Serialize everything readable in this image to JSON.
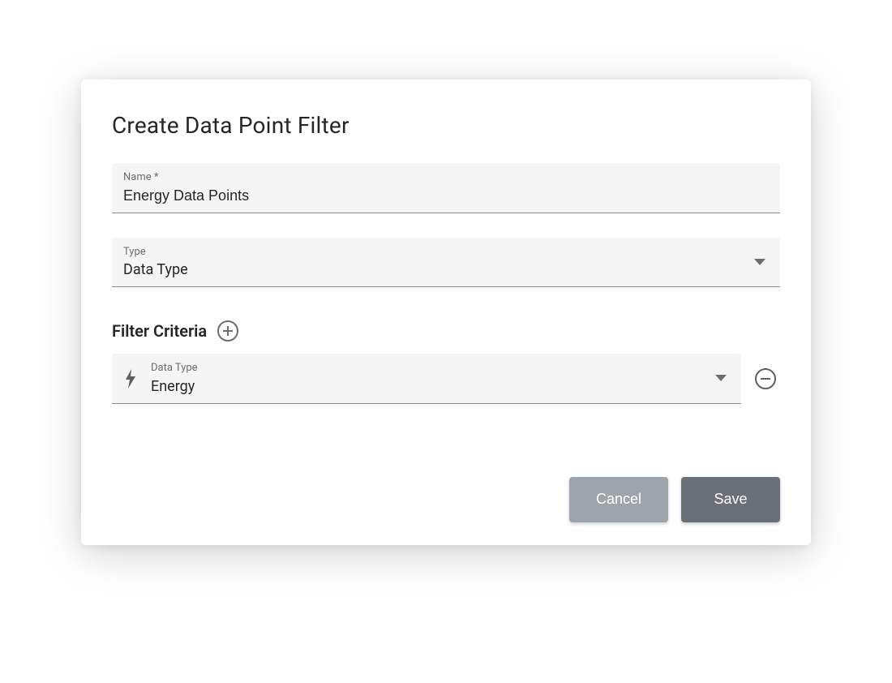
{
  "dialog": {
    "title": "Create Data Point Filter"
  },
  "fields": {
    "name": {
      "label": "Name *",
      "value": "Energy Data Points"
    },
    "type": {
      "label": "Type",
      "value": "Data Type"
    }
  },
  "filter_criteria": {
    "heading": "Filter Criteria",
    "items": [
      {
        "label": "Data Type",
        "value": "Energy",
        "icon": "bolt"
      }
    ]
  },
  "buttons": {
    "cancel": "Cancel",
    "save": "Save"
  }
}
